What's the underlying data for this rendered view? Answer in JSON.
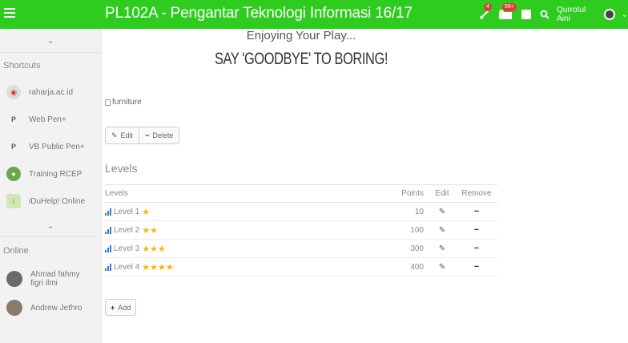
{
  "topbar": {
    "title": "PL102A - Pengantar Teknologi Informasi 16/17",
    "notif_badge_1": "4",
    "notif_badge_2": "99+",
    "user_name": "Qurrotul Aini"
  },
  "sidebar": {
    "shortcuts_label": "Shortcuts",
    "shortcuts": [
      {
        "label": "raharja.ac.id",
        "icon": "raharja-logo-icon",
        "color": "#bbbbbb"
      },
      {
        "label": "Web Pen+",
        "icon": "pen-plus-logo-icon",
        "color": "#6b8e23"
      },
      {
        "label": "VB Public Pen+",
        "icon": "pen-plus-logo-icon",
        "color": "#6b8e23"
      },
      {
        "label": "Training RCEP",
        "icon": "rcep-globe-icon",
        "color": "#4caf50"
      },
      {
        "label": "iDuHelp! Online",
        "icon": "iduhelp-logo-icon",
        "color": "#8bc34a"
      }
    ],
    "online_label": "Online",
    "online": [
      {
        "name_line1": "Ahmad fahmy",
        "name_line2": "figri ilmi"
      },
      {
        "name_line1": "Andrew Jethro",
        "name_line2": ""
      }
    ]
  },
  "main": {
    "subtitle": "Enjoying Your Play...",
    "banner": "SAY 'GOODBYE' TO BORING!",
    "image_alt": "furniture",
    "edit_label": "Edit",
    "delete_label": "Delete",
    "levels_heading": "Levels",
    "table": {
      "headers": [
        "Levels",
        "Points",
        "Edit",
        "Remove"
      ],
      "rows": [
        {
          "name": "Level 1",
          "stars": "★",
          "points": "10"
        },
        {
          "name": "Level 2",
          "stars": "★★",
          "points": "100"
        },
        {
          "name": "Level 3",
          "stars": "★★★",
          "points": "300"
        },
        {
          "name": "Level 4",
          "stars": "★★★★",
          "points": "400"
        }
      ]
    },
    "add_label": "Add"
  }
}
